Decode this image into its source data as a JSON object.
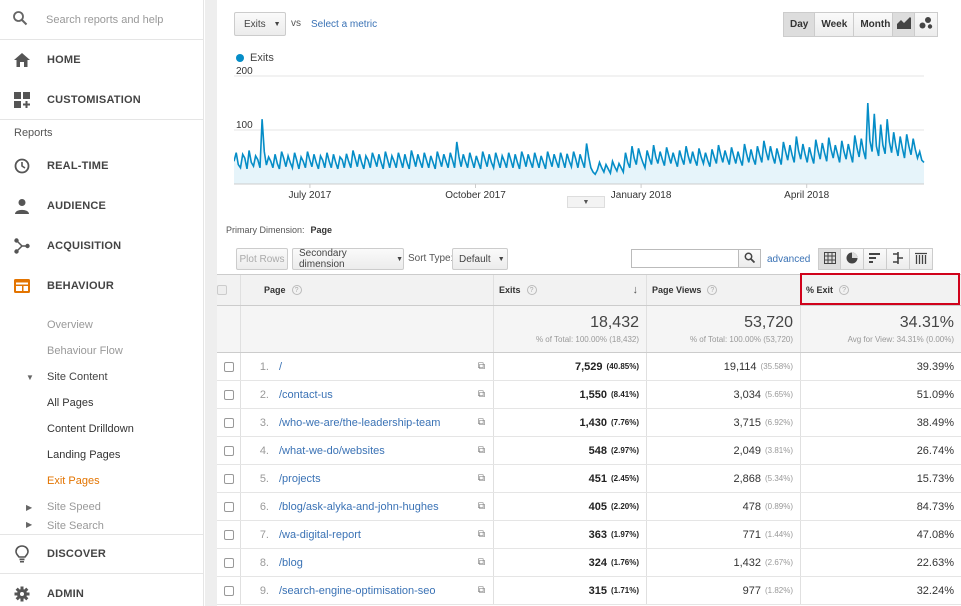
{
  "sidebar": {
    "search_placeholder": "Search reports and help",
    "home": "HOME",
    "customisation": "CUSTOMISATION",
    "reports_heading": "Reports",
    "realtime": "REAL-TIME",
    "audience": "AUDIENCE",
    "acquisition": "ACQUISITION",
    "behaviour": "BEHAVIOUR",
    "overview": "Overview",
    "behaviour_flow": "Behaviour Flow",
    "site_content": "Site Content",
    "all_pages": "All Pages",
    "content_drilldown": "Content Drilldown",
    "landing_pages": "Landing Pages",
    "exit_pages": "Exit Pages",
    "site_speed": "Site Speed",
    "site_search": "Site Search",
    "discover": "DISCOVER",
    "admin": "ADMIN",
    "accent_color": "#e37400"
  },
  "toolbar": {
    "metric": "Exits",
    "vs": "vs",
    "select_metric": "Select a metric",
    "day": "Day",
    "week": "Week",
    "month": "Month"
  },
  "chart_data": {
    "type": "area",
    "series": [
      {
        "name": "Exits",
        "color": "#058dc7"
      }
    ],
    "x_ticks": [
      "July 2017",
      "October 2017",
      "January 2018",
      "April 2018"
    ],
    "y_ticks": [
      200,
      100
    ],
    "ylim": [
      0,
      200
    ],
    "values": [
      42,
      58,
      36,
      30,
      55,
      48,
      28,
      62,
      40,
      33,
      52,
      45,
      30,
      120,
      60,
      35,
      50,
      42,
      30,
      55,
      38,
      28,
      60,
      48,
      32,
      52,
      40,
      30,
      58,
      44,
      28,
      50,
      42,
      30,
      60,
      45,
      32,
      55,
      40,
      28,
      52,
      44,
      30,
      58,
      42,
      30,
      55,
      40,
      28,
      50,
      45,
      30,
      56,
      42,
      30,
      62,
      48,
      32,
      55,
      40,
      28,
      52,
      44,
      30,
      58,
      46,
      32,
      55,
      40,
      28,
      60,
      45,
      30,
      52,
      42,
      30,
      58,
      44,
      30,
      55,
      40,
      28,
      62,
      48,
      32,
      55,
      42,
      30,
      58,
      44,
      30,
      52,
      40,
      28,
      60,
      46,
      32,
      55,
      42,
      30,
      58,
      44,
      30,
      78,
      50,
      32,
      55,
      42,
      30,
      58,
      44,
      30,
      52,
      40,
      28,
      60,
      46,
      32,
      55,
      40,
      30,
      58,
      44,
      30,
      52,
      42,
      30,
      58,
      44,
      30,
      55,
      40,
      28,
      60,
      48,
      32,
      55,
      42,
      30,
      58,
      44,
      30,
      52,
      40,
      28,
      60,
      46,
      32,
      55,
      42,
      30,
      58,
      44,
      30,
      56,
      42,
      32,
      60,
      46,
      30,
      55,
      42,
      30,
      75,
      50,
      30,
      22,
      18,
      26,
      40,
      30,
      22,
      36,
      28,
      20,
      42,
      32,
      24,
      38,
      30,
      22,
      58,
      40,
      30,
      70,
      48,
      36,
      66,
      52,
      40,
      30,
      62,
      48,
      36,
      72,
      50,
      38,
      60,
      46,
      34,
      68,
      52,
      38,
      58,
      44,
      32,
      62,
      48,
      36,
      70,
      52,
      38,
      60,
      46,
      34,
      66,
      50,
      38,
      58,
      44,
      32,
      64,
      50,
      38,
      72,
      54,
      40,
      62,
      48,
      36,
      68,
      52,
      38,
      60,
      46,
      34,
      74,
      56,
      40,
      64,
      48,
      36,
      70,
      54,
      40,
      80,
      60,
      44,
      70,
      52,
      38,
      66,
      50,
      36,
      78,
      60,
      44,
      72,
      54,
      40,
      88,
      62,
      46,
      74,
      56,
      40,
      68,
      52,
      38,
      82,
      62,
      46,
      76,
      58,
      42,
      86,
      64,
      48,
      72,
      56,
      40,
      80,
      60,
      46,
      74,
      56,
      40,
      90,
      68,
      50,
      84,
      62,
      46,
      150,
      80,
      60,
      130,
      70,
      52,
      110,
      72,
      56,
      120,
      78,
      58,
      96,
      70,
      52,
      88,
      66,
      48,
      92,
      70,
      54,
      84,
      64,
      48,
      60,
      44,
      40
    ]
  },
  "primary_dimension": {
    "label": "Primary Dimension:",
    "value": "Page"
  },
  "table_tools": {
    "plot_rows": "Plot Rows",
    "secondary_dimension": "Secondary dimension",
    "sort_type_label": "Sort Type:",
    "sort_type": "Default",
    "advanced": "advanced"
  },
  "table": {
    "headers": {
      "page": "Page",
      "exits": "Exits",
      "page_views": "Page Views",
      "pct_exit": "% Exit"
    },
    "totals": {
      "exits": "18,432",
      "exits_sub": "% of Total: 100.00% (18,432)",
      "page_views": "53,720",
      "page_views_sub": "% of Total: 100.00% (53,720)",
      "pct_exit": "34.31%",
      "pct_exit_sub": "Avg for View: 34.31% (0.00%)"
    },
    "rows": [
      {
        "n": "1.",
        "page": "/",
        "exits": "7,529",
        "exits_pct": "(40.85%)",
        "pv": "19,114",
        "pv_pct": "(35.58%)",
        "pe": "39.39%"
      },
      {
        "n": "2.",
        "page": "/contact-us",
        "exits": "1,550",
        "exits_pct": "(8.41%)",
        "pv": "3,034",
        "pv_pct": "(5.65%)",
        "pe": "51.09%"
      },
      {
        "n": "3.",
        "page": "/who-we-are/the-leadership-team",
        "exits": "1,430",
        "exits_pct": "(7.76%)",
        "pv": "3,715",
        "pv_pct": "(6.92%)",
        "pe": "38.49%"
      },
      {
        "n": "4.",
        "page": "/what-we-do/websites",
        "exits": "548",
        "exits_pct": "(2.97%)",
        "pv": "2,049",
        "pv_pct": "(3.81%)",
        "pe": "26.74%"
      },
      {
        "n": "5.",
        "page": "/projects",
        "exits": "451",
        "exits_pct": "(2.45%)",
        "pv": "2,868",
        "pv_pct": "(5.34%)",
        "pe": "15.73%"
      },
      {
        "n": "6.",
        "page": "/blog/ask-alyka-and-john-hughes",
        "exits": "405",
        "exits_pct": "(2.20%)",
        "pv": "478",
        "pv_pct": "(0.89%)",
        "pe": "84.73%"
      },
      {
        "n": "7.",
        "page": "/wa-digital-report",
        "exits": "363",
        "exits_pct": "(1.97%)",
        "pv": "771",
        "pv_pct": "(1.44%)",
        "pe": "47.08%"
      },
      {
        "n": "8.",
        "page": "/blog",
        "exits": "324",
        "exits_pct": "(1.76%)",
        "pv": "1,432",
        "pv_pct": "(2.67%)",
        "pe": "22.63%"
      },
      {
        "n": "9.",
        "page": "/search-engine-optimisation-seo",
        "exits": "315",
        "exits_pct": "(1.71%)",
        "pv": "977",
        "pv_pct": "(1.82%)",
        "pe": "32.24%"
      }
    ]
  }
}
